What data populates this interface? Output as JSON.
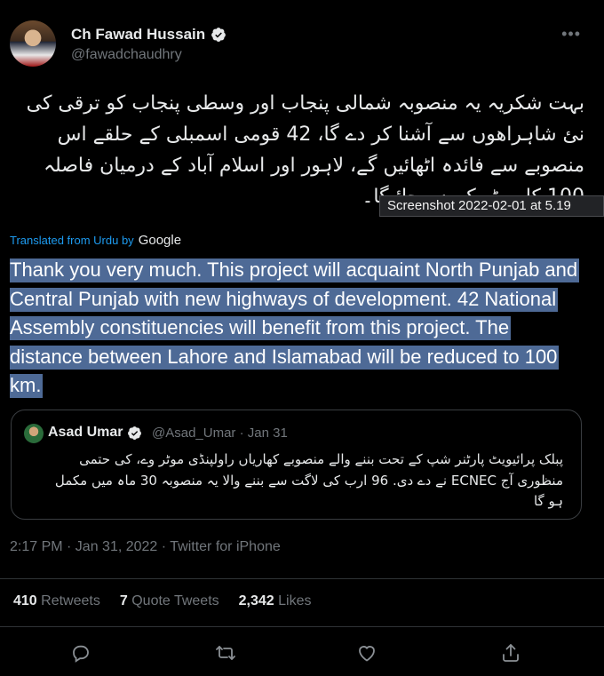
{
  "tweet": {
    "author_name": "Ch Fawad Hussain",
    "author_handle": "@fawadchaudhry",
    "text_urdu": "بہت شکریہ یہ منصوبہ شمالی پنجاب اور وسطی پنجاب کو ترقی کی نئ شاہراھوں سے آشنا کر دے گا، 42 قومی اسمبلی کے حلقے اس منصوبے سے فائدہ اٹھائیں گے، لاہور اور اسلام آباد کے درمیان فاصلہ 100 کلومیٹر کم ہو جائیگا۔",
    "translated_label": "Translated from Urdu by",
    "translator": "Google",
    "translation": "Thank you very much. This project will acquaint North Punjab and Central Punjab with new highways of development. 42 National Assembly constituencies will benefit from this project. The distance between Lahore and Islamabad will be reduced to 100 km.",
    "timestamp": "2:17 PM · Jan 31, 2022 · Twitter for iPhone",
    "stats": {
      "retweets_count": "410",
      "retweets_label": "Retweets",
      "quotes_count": "7",
      "quotes_label": "Quote Tweets",
      "likes_count": "2,342",
      "likes_label": "Likes"
    }
  },
  "quoted_tweet": {
    "author_name": "Asad Umar",
    "meta": "@Asad_Umar · Jan 31",
    "text_urdu": "پبلک پرائیویٹ پارٹنر شپ کے تحت بننے والے منصوبے کھاریاں راولپنڈی موٹر وے، کی حتمی منظوری آج ECNEC نے دے دی. 96 ارب کی لاگت سے بننے والا یہ منصوبہ 30 ماہ میں مکمل ہو گا"
  },
  "overlay": {
    "tooltip": "Screenshot 2022-02-01 at 5.19"
  },
  "icons": [
    "verified-badge-icon",
    "more-icon",
    "reply-icon",
    "retweet-icon",
    "like-icon",
    "share-icon"
  ],
  "colors": {
    "accent": "#1d9bf0",
    "selection": "#4e6a96",
    "muted": "#71767b",
    "background": "#000000"
  }
}
